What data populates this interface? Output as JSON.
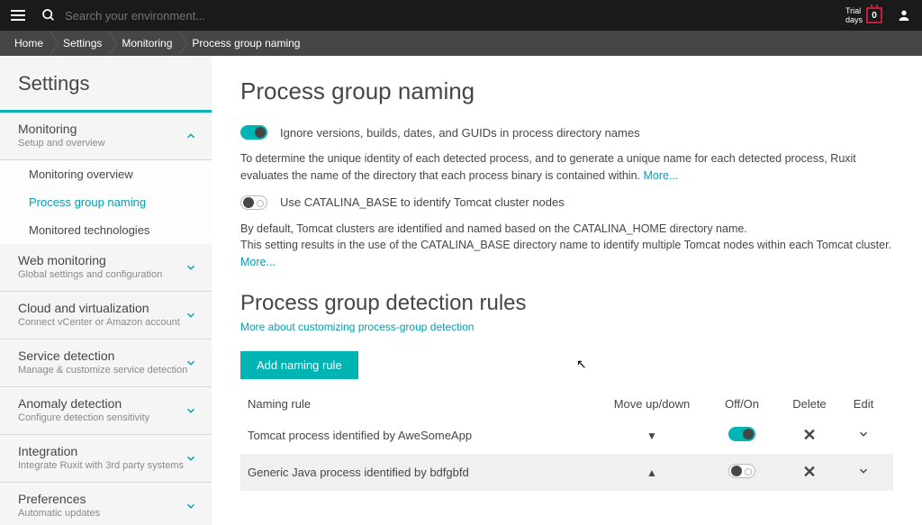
{
  "topbar": {
    "search_placeholder": "Search your environment...",
    "trial_label": "Trial\ndays",
    "trial_days": "0"
  },
  "breadcrumbs": [
    "Home",
    "Settings",
    "Monitoring",
    "Process group naming"
  ],
  "sidebar": {
    "title": "Settings",
    "sections": [
      {
        "title": "Monitoring",
        "sub": "Setup and overview",
        "expanded": true,
        "items": [
          "Monitoring overview",
          "Process group naming",
          "Monitored technologies"
        ],
        "active_index": 1
      },
      {
        "title": "Web monitoring",
        "sub": "Global settings and configuration"
      },
      {
        "title": "Cloud and virtualization",
        "sub": "Connect vCenter or Amazon account"
      },
      {
        "title": "Service detection",
        "sub": "Manage & customize service detection"
      },
      {
        "title": "Anomaly detection",
        "sub": "Configure detection sensitivity"
      },
      {
        "title": "Integration",
        "sub": "Integrate Ruxit with 3rd party systems"
      },
      {
        "title": "Preferences",
        "sub": "Automatic updates"
      }
    ]
  },
  "main": {
    "title": "Process group naming",
    "toggle1_label": "Ignore versions, builds, dates, and GUIDs in process directory names",
    "desc1": "To determine the unique identity of each detected process, and to generate a unique name for each detected process, Ruxit evaluates the name of the directory that each process binary is contained within. ",
    "more": "More...",
    "toggle2_label": "Use CATALINA_BASE to identify Tomcat cluster nodes",
    "desc2a": "By default, Tomcat clusters are identified and named based on the CATALINA_HOME directory name.",
    "desc2b": "This setting results in the use of the CATALINA_BASE directory name to identify multiple Tomcat nodes within each Tomcat cluster. ",
    "rules_title": "Process group detection rules",
    "rules_link": "More about customizing process-group detection",
    "add_label": "Add naming rule",
    "headers": {
      "name": "Naming rule",
      "move": "Move up/down",
      "onoff": "Off/On",
      "delete": "Delete",
      "edit": "Edit"
    },
    "rules": [
      {
        "name": "Tomcat process identified by AweSomeApp",
        "on": true,
        "move": "down"
      },
      {
        "name": "Generic Java process identified by bdfgbfd",
        "on": false,
        "move": "up"
      }
    ]
  }
}
